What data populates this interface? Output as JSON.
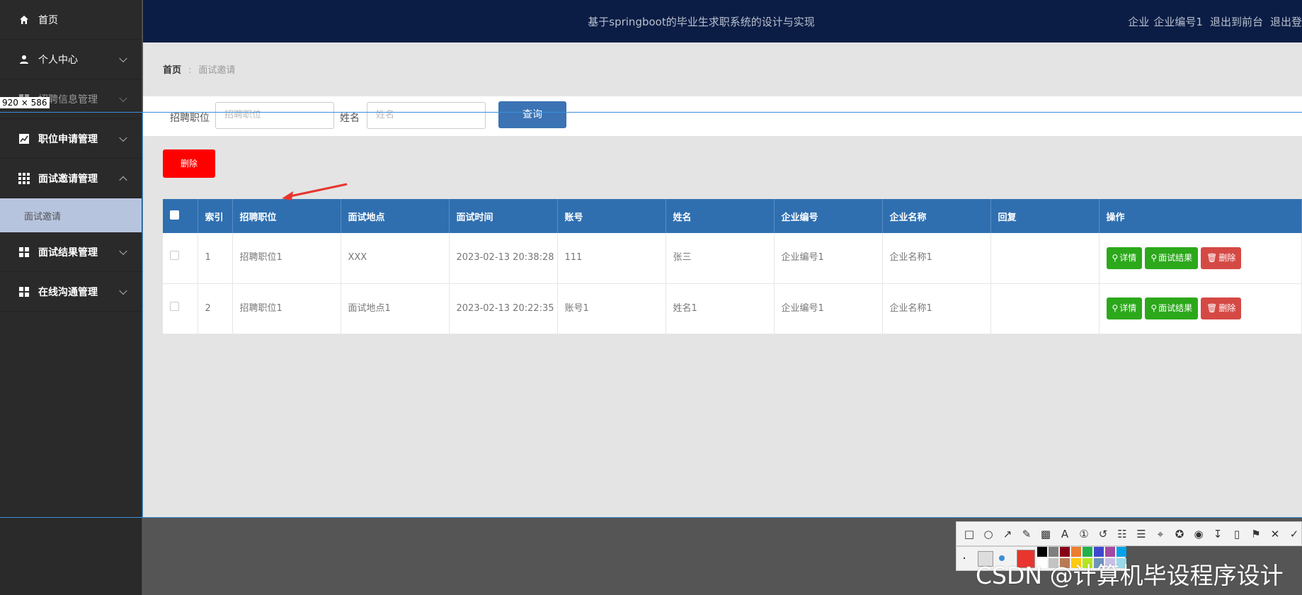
{
  "sidebar": {
    "items": [
      {
        "label": "首页"
      },
      {
        "label": "个人中心"
      },
      {
        "label": "招聘信息管理"
      },
      {
        "label": "职位申请管理"
      },
      {
        "label": "面试邀请管理"
      },
      {
        "label": "面试结果管理"
      },
      {
        "label": "在线沟通管理"
      }
    ],
    "submenu": {
      "label": "面试邀请"
    }
  },
  "header": {
    "title": "基于springboot的毕业生求职系统的设计与实现",
    "user_role": "企业",
    "user_name": "企业编号1",
    "to_front": "退出到前台",
    "logout": "退出登"
  },
  "breadcrumb": {
    "home": "首页",
    "sep": ":",
    "current": "面试邀请"
  },
  "search": {
    "job_label": "招聘职位",
    "job_placeholder": "招聘职位",
    "name_label": "姓名",
    "name_placeholder": "姓名",
    "query_button": "查询"
  },
  "toolbar": {
    "delete_label": "删除"
  },
  "table": {
    "columns": [
      "索引",
      "招聘职位",
      "面试地点",
      "面试时间",
      "账号",
      "姓名",
      "企业编号",
      "企业名称",
      "回复",
      "操作"
    ],
    "rows": [
      {
        "index": "1",
        "job": "招聘职位1",
        "place": "XXX",
        "time": "2023-02-13 20:38:28",
        "account": "111",
        "name": "张三",
        "company_no": "企业编号1",
        "company_name": "企业名称1",
        "reply": ""
      },
      {
        "index": "2",
        "job": "招聘职位1",
        "place": "面试地点1",
        "time": "2023-02-13 20:22:35",
        "account": "账号1",
        "name": "姓名1",
        "company_no": "企业编号1",
        "company_name": "企业名称1",
        "reply": ""
      }
    ],
    "actions": {
      "detail": "详情",
      "result": "面试结果",
      "delete": "删除"
    }
  },
  "overlay": {
    "size_label": "920 × 586",
    "watermark": "CSDN @计算机毕设程序设计"
  },
  "colors": {
    "sidebar_bg": "#2a2a2a",
    "topbar_bg": "#0b1d45",
    "table_header": "#2f6fb0",
    "delete_red": "#ff0000",
    "action_green": "#2ca81b",
    "action_red": "#d54944",
    "submenu_bg": "#b7c4de"
  }
}
